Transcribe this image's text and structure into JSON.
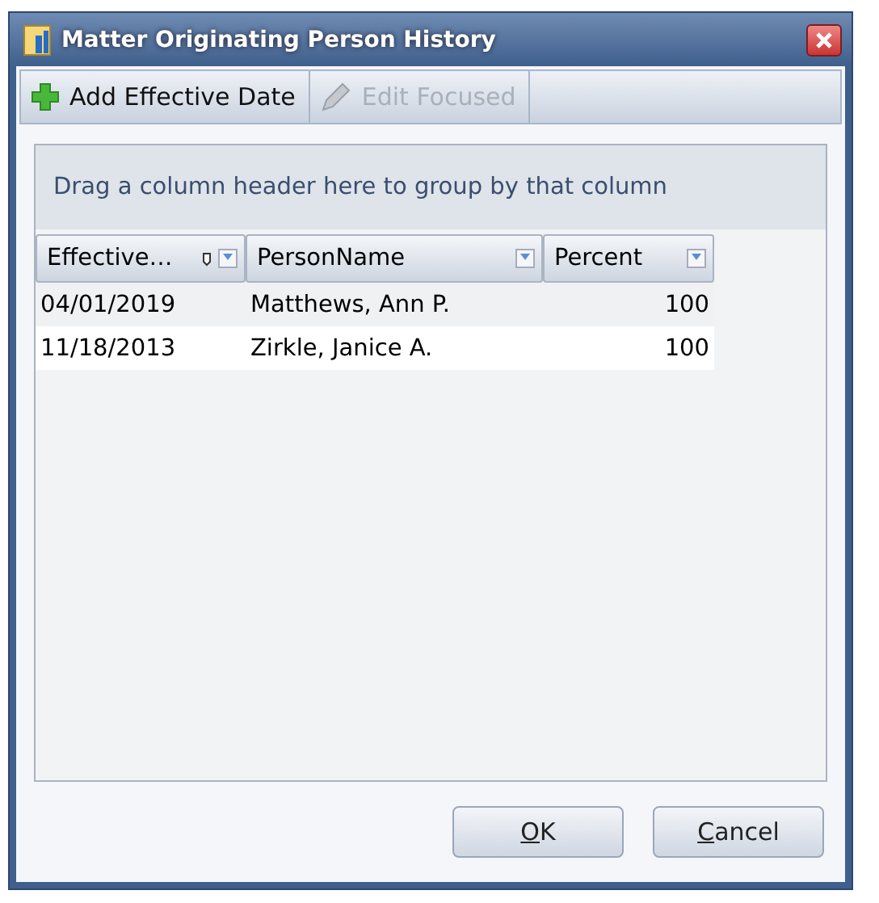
{
  "window": {
    "title": "Matter Originating Person History"
  },
  "toolbar": [
    {
      "label": "Add Effective Date",
      "kind": "add",
      "disabled": false
    },
    {
      "label": "Edit Focused",
      "kind": "edit",
      "disabled": true
    }
  ],
  "grid": {
    "group_hint": "Drag a column header here to group by that column",
    "columns": [
      {
        "label": "Effective…",
        "sorted": true,
        "kind": "text"
      },
      {
        "label": "PersonName",
        "sorted": false,
        "kind": "text"
      },
      {
        "label": "Percent",
        "sorted": false,
        "kind": "number"
      }
    ],
    "rows": [
      [
        "04/01/2019",
        "Matthews, Ann P.",
        "100"
      ],
      [
        "11/18/2013",
        "Zirkle, Janice A.",
        "100"
      ]
    ]
  },
  "buttons": [
    {
      "mnemonic": "O",
      "rest": "K"
    },
    {
      "mnemonic": "C",
      "rest": "ancel"
    }
  ]
}
